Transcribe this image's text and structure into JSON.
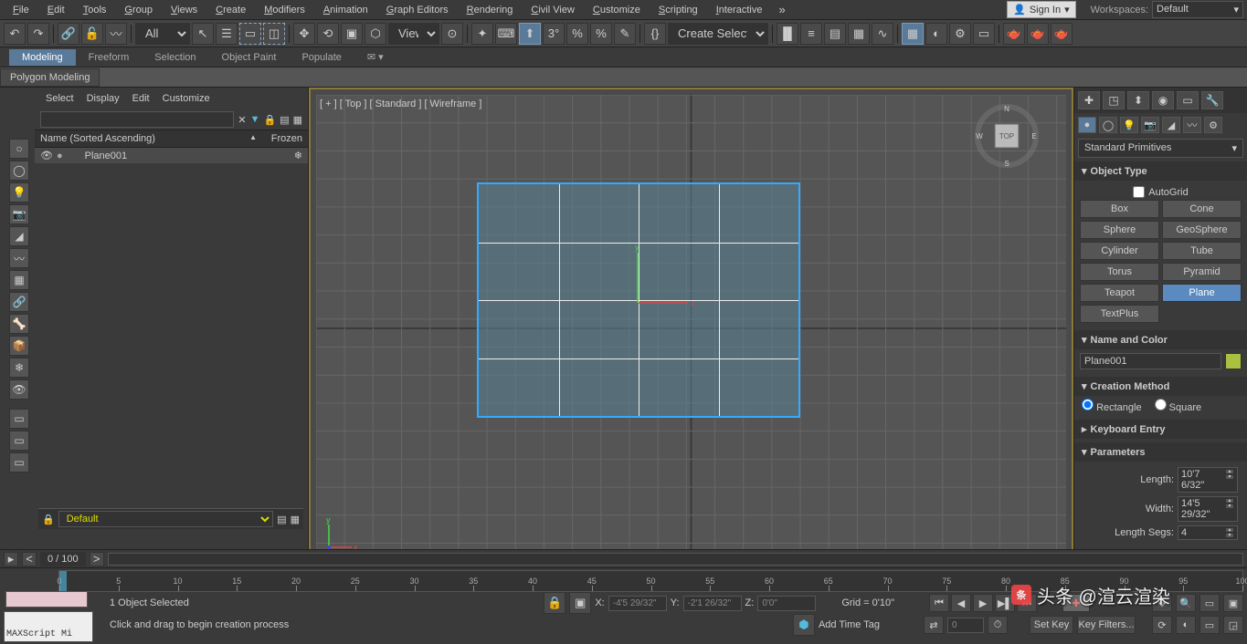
{
  "menu": [
    "File",
    "Edit",
    "Tools",
    "Group",
    "Views",
    "Create",
    "Modifiers",
    "Animation",
    "Graph Editors",
    "Rendering",
    "Civil View",
    "Customize",
    "Scripting",
    "Interactive"
  ],
  "signin": "Sign In",
  "workspaces_label": "Workspaces:",
  "workspaces_value": "Default",
  "toolbar": {
    "all": "All",
    "view": "View",
    "create_sel": "Create Selection Se"
  },
  "ribbon": [
    "Modeling",
    "Freeform",
    "Selection",
    "Object Paint",
    "Populate"
  ],
  "ribbon_panel": "Polygon Modeling",
  "scene_explorer": {
    "tabs": [
      "Select",
      "Display",
      "Edit",
      "Customize"
    ],
    "col_name": "Name (Sorted Ascending)",
    "col_frozen": "Frozen",
    "item": "Plane001"
  },
  "viewport": {
    "labels": "[ + ] [ Top ] [ Standard ] [ Wireframe ]",
    "cube_face": "TOP",
    "compass": {
      "n": "N",
      "s": "S",
      "e": "E",
      "w": "W"
    }
  },
  "command_panel": {
    "dropdown": "Standard Primitives",
    "obj_type": "Object Type",
    "autogrid": "AutoGrid",
    "types": [
      "Box",
      "Cone",
      "Sphere",
      "GeoSphere",
      "Cylinder",
      "Tube",
      "Torus",
      "Pyramid",
      "Teapot",
      "Plane",
      "TextPlus"
    ],
    "name_color": "Name and Color",
    "name_value": "Plane001",
    "creation_method": "Creation Method",
    "rect": "Rectangle",
    "square": "Square",
    "keyboard_entry": "Keyboard Entry",
    "parameters": "Parameters",
    "length_lbl": "Length:",
    "length_val": "10'7 6/32\"",
    "width_lbl": "Width:",
    "width_val": "14'5 29/32\"",
    "lsegs_lbl": "Length Segs:",
    "lsegs_val": "4"
  },
  "track": "0 / 100",
  "timeline_ticks": [
    0,
    5,
    10,
    15,
    20,
    25,
    30,
    35,
    40,
    45,
    50,
    55,
    60,
    65,
    70,
    75,
    80,
    85,
    90,
    95,
    100
  ],
  "status": {
    "selected": "1 Object Selected",
    "hint": "Click and drag to begin creation process",
    "x_lbl": "X:",
    "x": "-4'5 29/32\"",
    "y_lbl": "Y:",
    "y": "-2'1 26/32\"",
    "z_lbl": "Z:",
    "z": "0'0\"",
    "grid": "Grid = 0'10\"",
    "add_tag": "Add Time Tag",
    "frame": "0",
    "set_key": "Set Key",
    "key_filters": "Key Filters..."
  },
  "default_layer": "Default",
  "maxscript": "MAXScript Mi",
  "watermark": "头条 @渲云渲染"
}
